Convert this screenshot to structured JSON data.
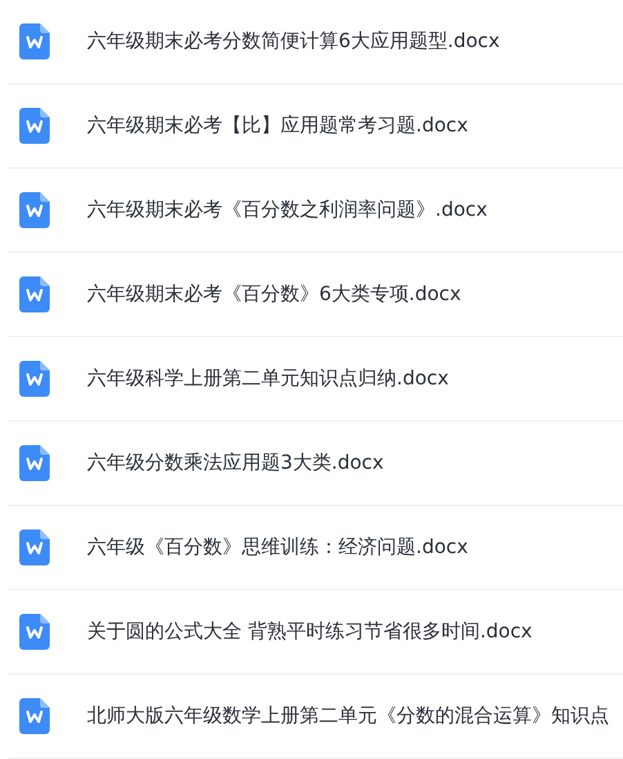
{
  "files": [
    {
      "name": "六年级期末必考分数简便计算6大应用题型.docx"
    },
    {
      "name": "六年级期末必考【比】应用题常考习题.docx"
    },
    {
      "name": "六年级期末必考《百分数之利润率问题》.docx"
    },
    {
      "name": "六年级期末必考《百分数》6大类专项.docx"
    },
    {
      "name": "六年级科学上册第二单元知识点归纳.docx"
    },
    {
      "name": "六年级分数乘法应用题3大类.docx"
    },
    {
      "name": "六年级《百分数》思维训练：经济问题.docx"
    },
    {
      "name": "关于圆的公式大全 背熟平时练习节省很多时间.docx"
    },
    {
      "name": "北师大版六年级数学上册第二单元《分数的混合运算》知识点"
    }
  ]
}
